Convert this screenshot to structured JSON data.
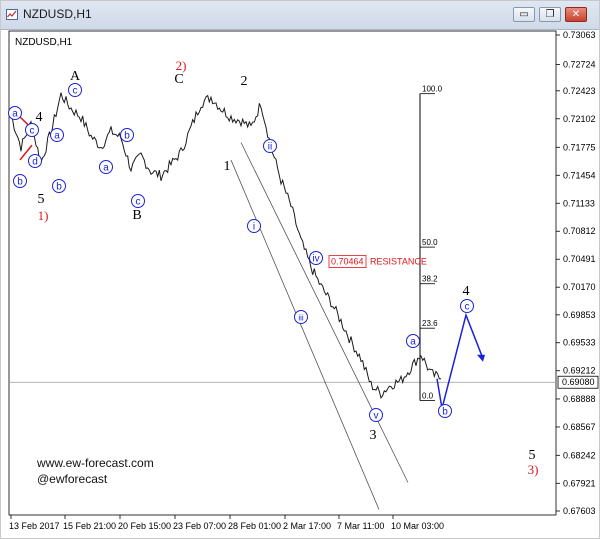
{
  "window": {
    "title": "NZDUSD,H1",
    "minimize_symbol": "▭",
    "restore_symbol": "❐",
    "close_symbol": "✕",
    "icon": "chart-window-icon"
  },
  "chart_data": {
    "type": "line",
    "symbol_label": "NZDUSD,H1",
    "ylim": [
      0.67603,
      0.73063
    ],
    "y_ticks": [
      "0.73063",
      "0.72724",
      "0.72423",
      "0.72102",
      "0.71775",
      "0.71454",
      "0.71133",
      "0.70812",
      "0.70491",
      "0.70170",
      "0.69853",
      "0.69533",
      "0.69212",
      "0.68888",
      "0.68567",
      "0.68242",
      "0.67921",
      "0.67603"
    ],
    "x_ticks": [
      "13 Feb 2017",
      "15 Feb 21:00",
      "20 Feb 15:00",
      "23 Feb 07:00",
      "28 Feb 01:00",
      "2 Mar 17:00",
      "7 Mar 11:00",
      "10 Mar 03:00"
    ],
    "current_price": "0.69080",
    "series": [
      {
        "x": [
          0,
          10,
          20,
          30,
          40,
          50,
          60,
          70,
          80,
          90,
          100,
          110,
          120,
          130,
          140,
          150,
          160,
          170,
          180,
          190,
          200,
          210,
          220,
          230,
          240,
          250,
          260,
          270,
          280,
          290,
          300,
          310,
          320,
          330,
          340,
          350,
          360,
          370,
          380,
          390,
          400,
          410,
          420,
          430
        ],
        "y": [
          0.7214,
          0.7178,
          0.7205,
          0.716,
          0.7195,
          0.7238,
          0.7222,
          0.7212,
          0.719,
          0.7178,
          0.7196,
          0.7188,
          0.7153,
          0.7168,
          0.715,
          0.7145,
          0.7158,
          0.7172,
          0.72,
          0.7228,
          0.7235,
          0.7222,
          0.7212,
          0.7208,
          0.72,
          0.7228,
          0.7178,
          0.714,
          0.711,
          0.707,
          0.704,
          0.7018,
          0.7,
          0.6978,
          0.6955,
          0.6935,
          0.6905,
          0.6895,
          0.6905,
          0.691,
          0.6925,
          0.694,
          0.6918,
          0.6912
        ]
      }
    ],
    "fib_levels": [
      {
        "label": "100.0",
        "y": 0.7239
      },
      {
        "label": "50.0",
        "y": 0.7063
      },
      {
        "label": "38.2",
        "y": 0.7021
      },
      {
        "label": "23.6",
        "y": 0.697
      },
      {
        "label": "0.0",
        "y": 0.6887
      }
    ],
    "resistance": {
      "value_label": "0.70464",
      "text": "RESISTANCE",
      "y": 0.70464
    },
    "wave_labels": {
      "A": "A",
      "C": "C",
      "two_black": "2",
      "two_red": "2)",
      "one_black": "1",
      "one_red": "1)",
      "four_left": "4",
      "five_left": "5",
      "B": "B",
      "three_black": "3",
      "four_right": "4",
      "five_right": "5",
      "three_red": "3)",
      "circled": [
        "a",
        "c",
        "c",
        "a",
        "b",
        "d",
        "b",
        "b",
        "a",
        "b",
        "c",
        "ii",
        "i",
        "iv",
        "iii",
        "v",
        "a",
        "b",
        "c"
      ]
    }
  },
  "watermark": {
    "site": "www.ew-forecast.com",
    "handle": "@ewforecast"
  },
  "colors": {
    "price": "#1a1a1a",
    "circled": "#1b22d8",
    "red": "#e0151c",
    "projection": "#1b22d8",
    "grid": "#9a9a9a"
  }
}
